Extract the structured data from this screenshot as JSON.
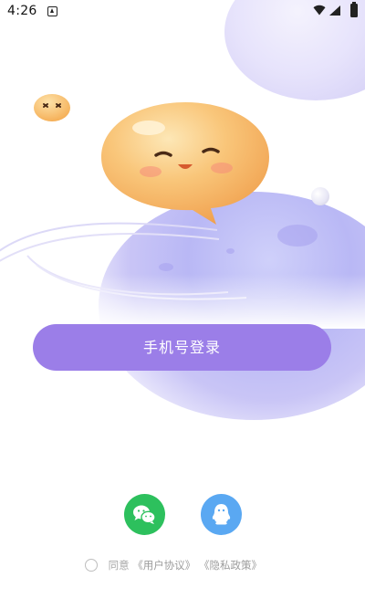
{
  "status_bar": {
    "time": "4:26",
    "icons": [
      "notification-icon",
      "wifi-icon",
      "signal-icon",
      "battery-icon"
    ]
  },
  "illustration": {
    "icons": [
      "mascot-large-icon",
      "mascot-small-icon",
      "planet-icon",
      "orbit-ring-icon"
    ]
  },
  "login": {
    "phone_button_label": "手机号登录",
    "accent_color": "#9b7ee8"
  },
  "social": {
    "wechat_icon": "wechat-icon",
    "wechat_color": "#2dc05d",
    "qq_icon": "qq-icon",
    "qq_color": "#5aa8f2"
  },
  "agreement": {
    "agree_text": "同意",
    "user_agreement": "《用户协议》",
    "privacy_policy": "《隐私政策》",
    "checked": false
  }
}
